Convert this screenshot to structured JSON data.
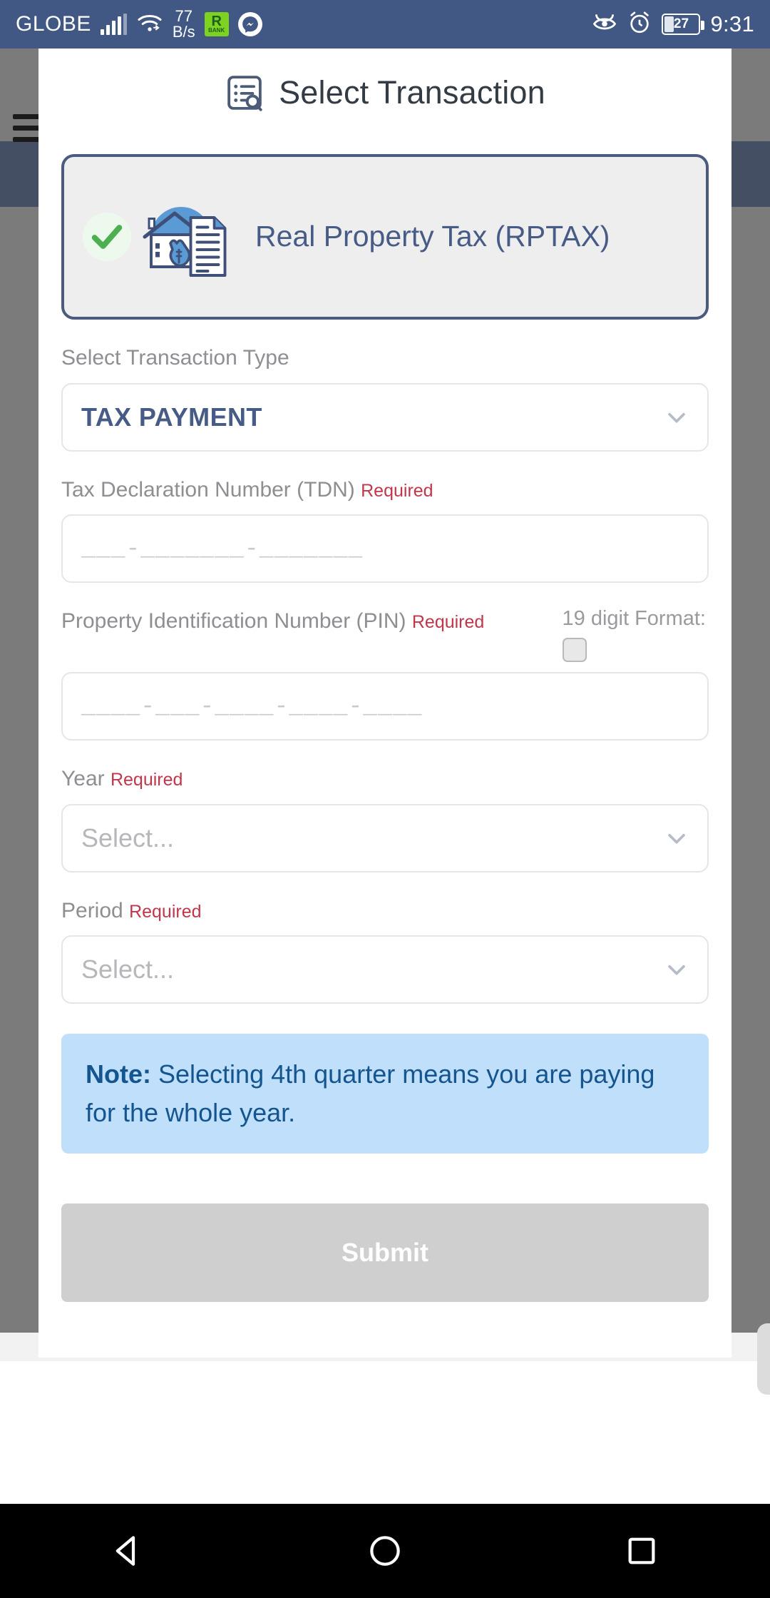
{
  "status_bar": {
    "carrier": "GLOBE",
    "net_speed_value": "77",
    "net_speed_unit": "B/s",
    "app_badge_letter": "R",
    "app_badge_sub": "BANK",
    "battery_percent": "27",
    "clock": "9:31",
    "icons": [
      "signal-icon",
      "wifi-icon",
      "messenger-icon",
      "eye-care-icon",
      "alarm-icon",
      "battery-icon"
    ]
  },
  "sheet": {
    "title": "Select Transaction",
    "title_icon": "list-search-icon"
  },
  "transaction_card": {
    "label": "Real Property Tax (RPTAX)",
    "selected": true,
    "check_icon": "check-circle-icon",
    "illustration": "house-money-document-icon"
  },
  "form": {
    "transaction_type": {
      "label": "Select Transaction Type",
      "value": "TAX PAYMENT",
      "chevron": "chevron-down-icon"
    },
    "tdn": {
      "label": "Tax Declaration Number (TDN)",
      "required_text": "Required",
      "placeholder": "___-_______-_______"
    },
    "pin": {
      "label": "Property Identification Number (PIN)",
      "required_text": "Required",
      "format_label": "19 digit Format:",
      "format_checked": false,
      "placeholder": "____-___-____-____-____"
    },
    "year": {
      "label": "Year",
      "required_text": "Required",
      "placeholder": "Select...",
      "chevron": "chevron-down-icon"
    },
    "period": {
      "label": "Period",
      "required_text": "Required",
      "placeholder": "Select...",
      "chevron": "chevron-down-icon"
    }
  },
  "note": {
    "prefix": "Note:",
    "text": " Selecting 4th quarter means you are paying for the whole year."
  },
  "submit": {
    "label": "Submit",
    "enabled": false
  },
  "nav_bar": {
    "items": [
      "back-triangle-icon",
      "home-circle-icon",
      "recents-square-icon"
    ]
  },
  "colors": {
    "status_bar_bg": "#415784",
    "accent_blue": "#465b85",
    "required_red": "#c0374b",
    "note_bg": "#bfdffb",
    "note_text": "#15558f",
    "submit_bg": "#cfcfcf"
  }
}
